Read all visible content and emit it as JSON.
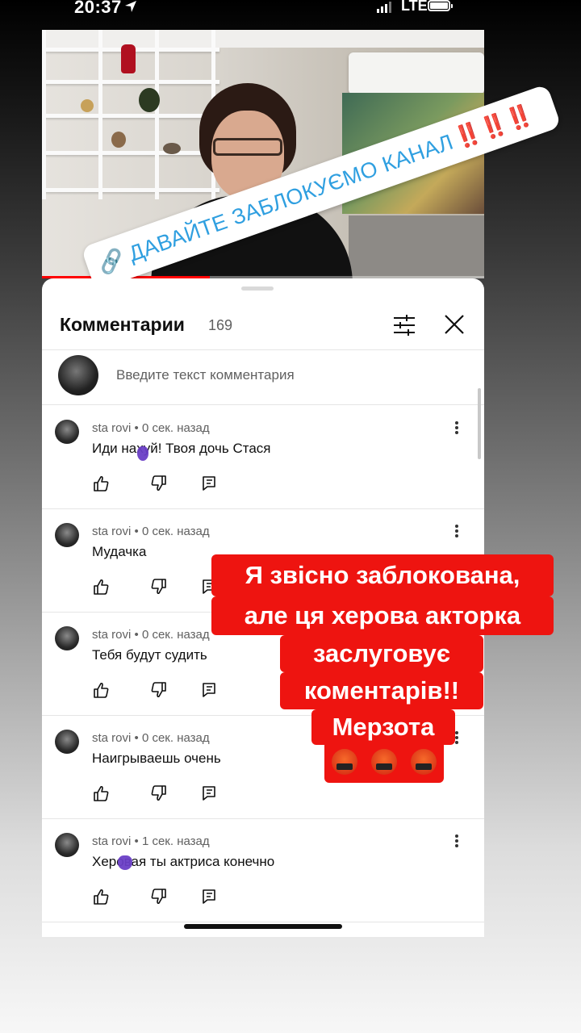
{
  "status_bar": {
    "time": "20:37",
    "network": "LTE"
  },
  "video": {
    "sticker_text": "ДАВАЙТЕ ЗАБЛОКУЄМО КАНАЛ",
    "sticker_emphasis": "‼️‼️‼️"
  },
  "comments_panel": {
    "title": "Комментарии",
    "count": "169",
    "compose_placeholder": "Введите текст комментария",
    "comments": [
      {
        "author": "sta rovi",
        "time": "• 0 сек. назад",
        "text": "Иди нахуй! Твоя дочь Стася"
      },
      {
        "author": "sta rovi",
        "time": "• 0 сек. назад",
        "text": "Мудачка"
      },
      {
        "author": "sta rovi",
        "time": "• 0 сек. назад",
        "text": "Тебя будут судить"
      },
      {
        "author": "sta rovi",
        "time": "• 0 сек. назад",
        "text": "Наигрываешь очень"
      },
      {
        "author": "sta rovi",
        "time": "• 1 сек. назад",
        "text": "Херовая ты актриса конечно"
      }
    ]
  },
  "caption": {
    "lines": [
      "Я звісно заблокована,",
      "але ця херова акторка",
      "заслуговує",
      "коментарів!!",
      "Мерзота"
    ],
    "emoji": [
      "🤬",
      "🤬",
      "🤬"
    ]
  },
  "colors": {
    "caption_bg": "#ee1410",
    "sticker_text": "#2f9fe0",
    "youtube_red": "#ff0000"
  }
}
